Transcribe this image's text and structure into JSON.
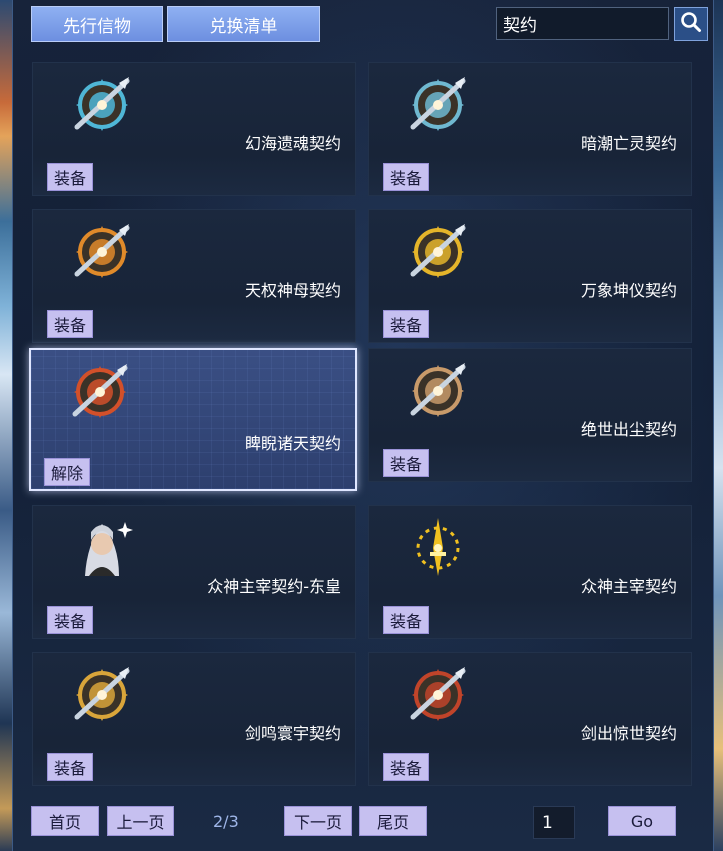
{
  "tabs": [
    {
      "label": "先行信物"
    },
    {
      "label": "兑换清单"
    }
  ],
  "search": {
    "value": "契约",
    "icon": "search-icon"
  },
  "items": [
    {
      "name": "幻海遗魂契约",
      "button": "装备",
      "icon": "sword-emblem-icon",
      "color": "#4fb6d6"
    },
    {
      "name": "暗潮亡灵契约",
      "button": "装备",
      "icon": "sword-emblem-icon",
      "color": "#6fb8d0"
    },
    {
      "name": "天权神母契约",
      "button": "装备",
      "icon": "jeweled-emblem-icon",
      "color": "#e08a2a"
    },
    {
      "name": "万象坤仪契约",
      "button": "装备",
      "icon": "golden-emblem-icon",
      "color": "#e5b52a"
    },
    {
      "name": "睥睨诸天契约",
      "button": "解除",
      "icon": "flame-emblem-icon",
      "color": "#d2502a",
      "selected": true
    },
    {
      "name": "绝世出尘契约",
      "button": "装备",
      "icon": "silver-emblem-icon",
      "color": "#c89a6a"
    },
    {
      "name": "众神主宰契约-东皇",
      "button": "装备",
      "icon": "character-portrait-icon",
      "color": "#c9ccd6"
    },
    {
      "name": "众神主宰契约",
      "button": "装备",
      "icon": "golden-blade-icon",
      "color": "#f0c020"
    },
    {
      "name": "剑鸣寰宇契约",
      "button": "装备",
      "icon": "golden-star-emblem-icon",
      "color": "#d9a53a"
    },
    {
      "name": "剑出惊世契约",
      "button": "装备",
      "icon": "crimson-emblem-icon",
      "color": "#c0442a"
    }
  ],
  "pagination": {
    "first": "首页",
    "prev": "上一页",
    "indicator": "2/3",
    "next": "下一页",
    "last": "尾页",
    "page_value": "1",
    "go": "Go"
  }
}
